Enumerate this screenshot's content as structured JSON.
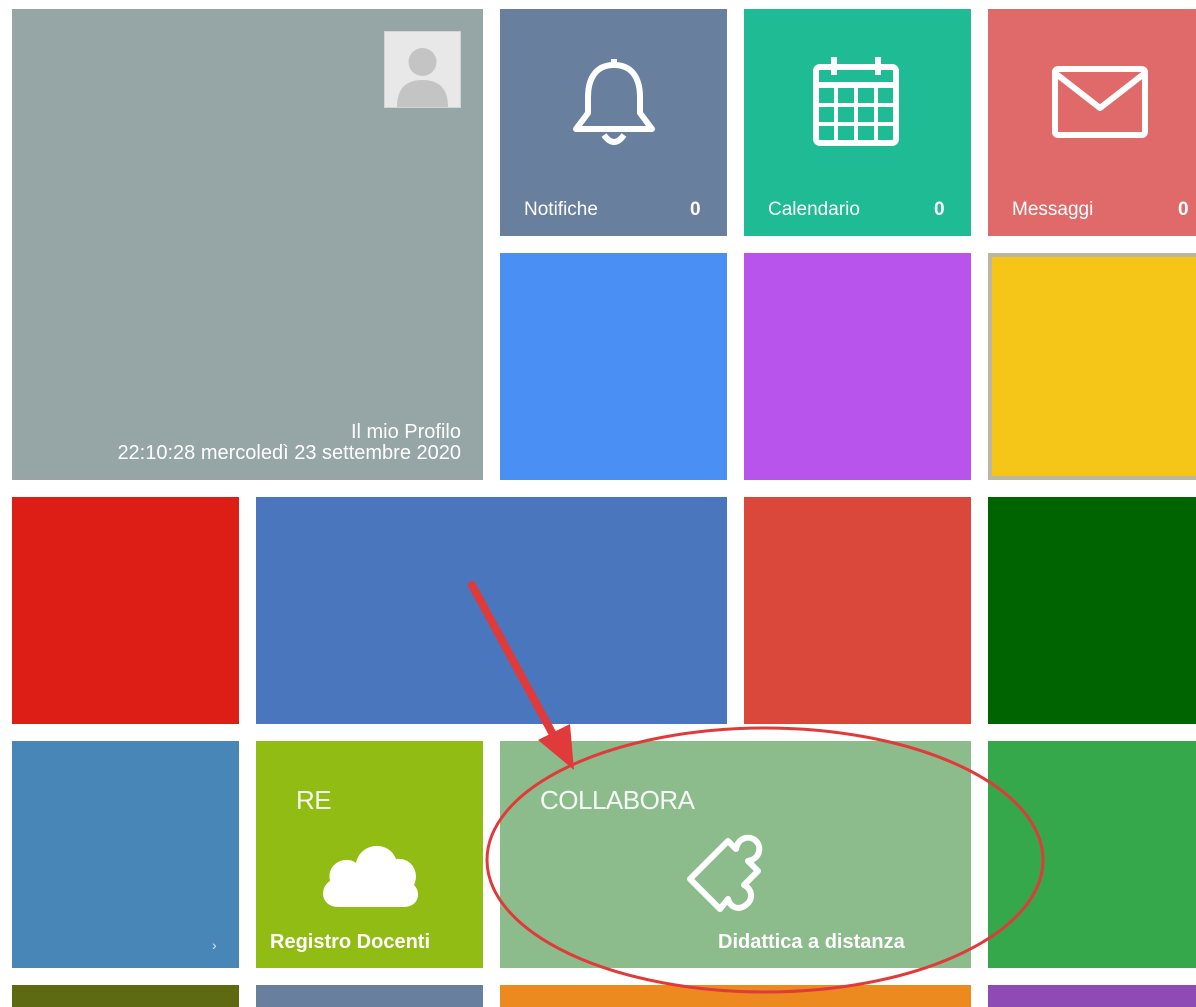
{
  "profile": {
    "title": "Il mio Profilo",
    "datetime": "22:10:28 mercoledì 23 settembre 2020",
    "avatar_icon": "user-placeholder-icon"
  },
  "notifications": {
    "label": "Notifiche",
    "count": "0",
    "icon": "bell-icon"
  },
  "calendar": {
    "label": "Calendario",
    "count": "0",
    "icon": "calendar-icon"
  },
  "messages": {
    "label": "Messaggi",
    "count": "0",
    "icon": "envelope-icon"
  },
  "registro": {
    "top": "RE",
    "label": "Registro Docenti",
    "icon": "cloud-icon"
  },
  "collabora": {
    "top": "COLLABORA",
    "label": "Didattica a distanza",
    "icon": "puzzle-icon"
  },
  "small_tile": {
    "arrow": "›"
  },
  "colors": {
    "profile": "#96a5a5",
    "notifications": "#687f9e",
    "calendar": "#1fbb95",
    "messages": "#e06a6a",
    "blue": "#4a8ff4",
    "purple": "#b854ec",
    "yellow": "#f5c518",
    "red": "#dc1e17",
    "wide_blue": "#4a76be",
    "orange_red": "#d9483a",
    "dark_green": "#006400",
    "steel_blue": "#4886b8",
    "lime": "#91bc14",
    "sage": "#8cbc8c",
    "green": "#34a84a",
    "annotation_red": "#e03a3a"
  }
}
